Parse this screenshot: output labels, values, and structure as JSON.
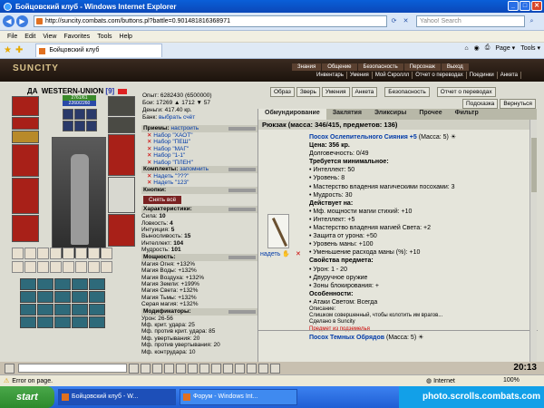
{
  "window": {
    "title": "Бойцовский клуб - Windows Internet Explorer",
    "controls": [
      "_",
      "□",
      "✕"
    ]
  },
  "address": {
    "url": "http://suncity.combats.com/buttons.pl?battle=0.901481816368971",
    "search_placeholder": "Yahoo! Search"
  },
  "menu": [
    "File",
    "Edit",
    "View",
    "Favorites",
    "Tools",
    "Help"
  ],
  "tab": {
    "label": "Бойцовский клуб"
  },
  "tools": {
    "page": "Page ▾",
    "tools": "Tools ▾"
  },
  "game": {
    "logo": "SUNCITY",
    "nav_top": [
      "Знания",
      "Общение",
      "Безопасность",
      "Персонаж",
      "Выход"
    ],
    "nav_sub": [
      "Инвентарь",
      "Умения",
      "Мой Скроллл",
      "Отчет о переводах",
      "Поединки",
      "Анкета"
    ]
  },
  "character": {
    "name": "WESTERN-UNION",
    "level": "[9]",
    "hp": "2761/61",
    "mp": "2260/2260"
  },
  "stats_top": {
    "exp": "Опыт: 6282430 (6500000)",
    "fights": "Бои: 17269",
    "fights2": "1712",
    "fights3": "57",
    "money": "Деньги: 417.40 кр.",
    "bank_label": "Банк:",
    "bank_link": "выбрать счёт"
  },
  "top_buttons": [
    "Образ",
    "Зверь",
    "Умения",
    "Анкета",
    "Безопасность",
    "Отчет о переводах"
  ],
  "hint_buttons": [
    "Подсказка",
    "Вернуться"
  ],
  "sets": {
    "header": "Приемы:",
    "header_link": "настроить",
    "items": [
      "Набор \"ХАОТ\"",
      "Набор \"ПЕШ\"",
      "Набор \"МАГ\"",
      "Набор \"1-1\"",
      "Набор \"ПЛЕН\""
    ]
  },
  "kits": {
    "header": "Комплекты:",
    "header_link": "запомнить",
    "items": [
      "Надеть \"???\"",
      "Надеть \"123\""
    ]
  },
  "buttons_section": {
    "header": "Кнопки:",
    "remove_all": "Снять всё"
  },
  "characteristics": {
    "header": "Характеристики:",
    "items": [
      {
        "label": "Сила:",
        "value": "10"
      },
      {
        "label": "Ловкость:",
        "value": "4"
      },
      {
        "label": "Интуиция:",
        "value": "5"
      },
      {
        "label": "Выносливость:",
        "value": "15"
      },
      {
        "label": "Интеллект:",
        "value": "104"
      },
      {
        "label": "Мудрость:",
        "value": "101"
      }
    ]
  },
  "powers": {
    "header": "Мощность:",
    "items": [
      "Магия Огня: +132%",
      "Магия Воды: +132%",
      "Магия Воздуха: +132%",
      "Магия Земли: +199%",
      "Магия Света: +132%",
      "Магия Тьмы: +132%",
      "Серая магия: +132%"
    ]
  },
  "modifiers": {
    "header": "Модификаторы:",
    "items": [
      "Урон: 26-56",
      "Мф. крит. удара: 25",
      "Мф. против крит. удара: 85",
      "Мф. увертывания: 20",
      "Мф. против увертывания: 20",
      "Мф. контрудара: 10"
    ]
  },
  "inventory": {
    "tabs": [
      "Обмундирование",
      "Заклятия",
      "Эликсиры",
      "Прочее",
      "Фильтр"
    ],
    "title": "Рюкзак (масса: 346/415, предметов: 136)",
    "wear_label": "надеть",
    "item": {
      "name": "Посох Ослепительного Сияния +5",
      "weight": "(Масса: 5)",
      "price": "Цена: 356 кр.",
      "durability": "Долговечность: 0/49",
      "req_header": "Требуется минимальное:",
      "requirements": [
        "• Интеллект: 50",
        "• Уровень: 8",
        "• Мастерство владения магическими посохами: 3",
        "• Мудрость: 30"
      ],
      "acts_header": "Действует на:",
      "acts": [
        "• Мф. мощности магии стихий: +10",
        "• Интеллект: +5",
        "• Мастерство владения магией Света: +2",
        "• Защита от урона: +50",
        "• Уровень маны: +100",
        "• Уменьшение расхода маны (%): +10"
      ],
      "props_header": "Свойства предмета:",
      "props": [
        "• Урон: 1 - 20",
        "• Двуручное оружие",
        "• Зоны блокирования: +"
      ],
      "features_header": "Особенности:",
      "features": [
        "• Атаки Светом: Всегда"
      ],
      "desc_label": "Описание:",
      "desc": "Слишком совершенный, чтобы колотить им врагов...",
      "made": "Сделано в Suncity",
      "nodrop": "Предмет из подземелья"
    },
    "item2": {
      "name": "Посох Темных Обрядов",
      "weight": "(Масса: 5)"
    }
  },
  "game_toolbar": {
    "clock": "20:13"
  },
  "status": {
    "text": "Error on page.",
    "zone": "Internet",
    "zoom": "100%"
  },
  "taskbar": {
    "start": "start",
    "tasks": [
      "Бойцовский клуб - W...",
      "Форум - Windows Int..."
    ],
    "tray": "photo.scrolls.combats.com"
  }
}
